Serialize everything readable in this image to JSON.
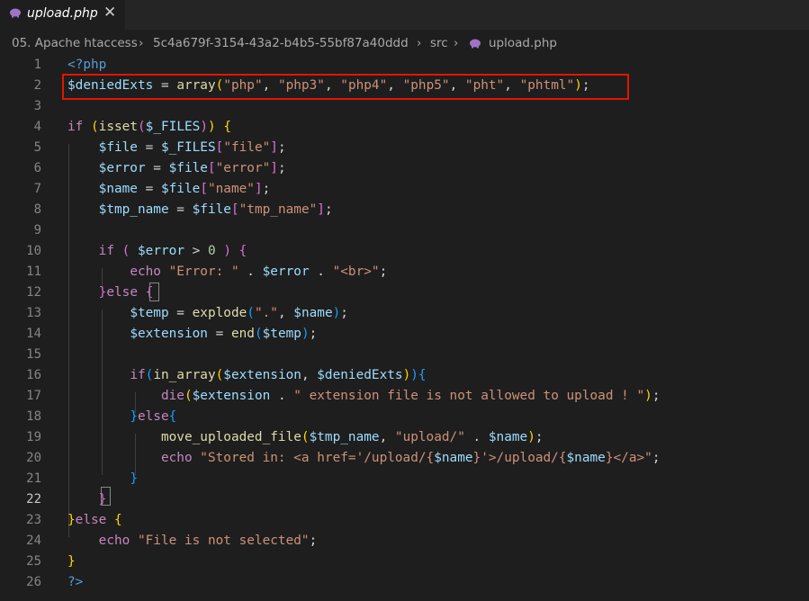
{
  "tab": {
    "label": "upload.php",
    "close": "✕",
    "icon": "php-elephant-icon"
  },
  "breadcrumb": {
    "items": [
      "05. Apache htaccess",
      "5c4a679f-3154-43a2-b4b5-55bf87a40ddd",
      "src",
      "upload.php"
    ],
    "separator": "›"
  },
  "editor": {
    "active_line": 22,
    "highlighted_line": 2,
    "highlight_color": "#e51400",
    "lines": [
      {
        "n": "1",
        "t": [
          [
            "<?php",
            "k"
          ]
        ]
      },
      {
        "n": "2",
        "t": [
          [
            "$deniedExts",
            "v"
          ],
          [
            " = ",
            ""
          ],
          [
            "array",
            "f"
          ],
          [
            "(",
            "p"
          ],
          [
            "\"php\"",
            "s"
          ],
          [
            ", ",
            ""
          ],
          [
            "\"php3\"",
            "s"
          ],
          [
            ", ",
            ""
          ],
          [
            "\"php4\"",
            "s"
          ],
          [
            ", ",
            ""
          ],
          [
            "\"php5\"",
            "s"
          ],
          [
            ", ",
            ""
          ],
          [
            "\"pht\"",
            "s"
          ],
          [
            ", ",
            ""
          ],
          [
            "\"phtml\"",
            "s"
          ],
          [
            ")",
            "p"
          ],
          [
            ";",
            ""
          ]
        ]
      },
      {
        "n": "3",
        "t": []
      },
      {
        "n": "4",
        "t": [
          [
            "if",
            "c"
          ],
          [
            " ",
            ""
          ],
          [
            "(",
            "p"
          ],
          [
            "isset",
            "f"
          ],
          [
            "(",
            "p2"
          ],
          [
            "$_FILES",
            "v"
          ],
          [
            ")",
            "p2"
          ],
          [
            ")",
            "p"
          ],
          [
            " ",
            ""
          ],
          [
            "{",
            "p"
          ]
        ]
      },
      {
        "n": "5",
        "t": [
          [
            "    ",
            ""
          ],
          [
            "$file",
            "v"
          ],
          [
            " = ",
            ""
          ],
          [
            "$_FILES",
            "v"
          ],
          [
            "[",
            "p2"
          ],
          [
            "\"file\"",
            "s"
          ],
          [
            "]",
            "p2"
          ],
          [
            ";",
            ""
          ]
        ]
      },
      {
        "n": "6",
        "t": [
          [
            "    ",
            ""
          ],
          [
            "$error",
            "v"
          ],
          [
            " = ",
            ""
          ],
          [
            "$file",
            "v"
          ],
          [
            "[",
            "p2"
          ],
          [
            "\"error\"",
            "s"
          ],
          [
            "]",
            "p2"
          ],
          [
            ";",
            ""
          ]
        ]
      },
      {
        "n": "7",
        "t": [
          [
            "    ",
            ""
          ],
          [
            "$name",
            "v"
          ],
          [
            " = ",
            ""
          ],
          [
            "$file",
            "v"
          ],
          [
            "[",
            "p2"
          ],
          [
            "\"name\"",
            "s"
          ],
          [
            "]",
            "p2"
          ],
          [
            ";",
            ""
          ]
        ]
      },
      {
        "n": "8",
        "t": [
          [
            "    ",
            ""
          ],
          [
            "$tmp_name",
            "v"
          ],
          [
            " = ",
            ""
          ],
          [
            "$file",
            "v"
          ],
          [
            "[",
            "p2"
          ],
          [
            "\"tmp_name\"",
            "s"
          ],
          [
            "]",
            "p2"
          ],
          [
            ";",
            ""
          ]
        ]
      },
      {
        "n": "9",
        "t": []
      },
      {
        "n": "10",
        "t": [
          [
            "    ",
            ""
          ],
          [
            "if",
            "c"
          ],
          [
            " ",
            ""
          ],
          [
            "(",
            "p2"
          ],
          [
            " ",
            ""
          ],
          [
            "$error",
            "v"
          ],
          [
            " > ",
            ""
          ],
          [
            "0",
            "n"
          ],
          [
            " ",
            ""
          ],
          [
            ")",
            "p2"
          ],
          [
            " ",
            ""
          ],
          [
            "{",
            "p2"
          ]
        ]
      },
      {
        "n": "11",
        "t": [
          [
            "        ",
            ""
          ],
          [
            "echo",
            "c"
          ],
          [
            " ",
            ""
          ],
          [
            "\"Error: \"",
            "s"
          ],
          [
            " . ",
            ""
          ],
          [
            "$error",
            "v"
          ],
          [
            " . ",
            ""
          ],
          [
            "\"<br>\"",
            "s"
          ],
          [
            ";",
            ""
          ]
        ]
      },
      {
        "n": "12",
        "t": [
          [
            "    ",
            ""
          ],
          [
            "}",
            "p2"
          ],
          [
            "else",
            "c"
          ],
          [
            " ",
            ""
          ],
          [
            "{",
            "p2"
          ]
        ]
      },
      {
        "n": "13",
        "t": [
          [
            "        ",
            ""
          ],
          [
            "$temp",
            "v"
          ],
          [
            " = ",
            ""
          ],
          [
            "explode",
            "f"
          ],
          [
            "(",
            "p3"
          ],
          [
            "\".\"",
            "s"
          ],
          [
            ", ",
            ""
          ],
          [
            "$name",
            "v"
          ],
          [
            ")",
            "p3"
          ],
          [
            ";",
            ""
          ]
        ]
      },
      {
        "n": "14",
        "t": [
          [
            "        ",
            ""
          ],
          [
            "$extension",
            "v"
          ],
          [
            " = ",
            ""
          ],
          [
            "end",
            "f"
          ],
          [
            "(",
            "p3"
          ],
          [
            "$temp",
            "v"
          ],
          [
            ")",
            "p3"
          ],
          [
            ";",
            ""
          ]
        ]
      },
      {
        "n": "15",
        "t": []
      },
      {
        "n": "16",
        "t": [
          [
            "        ",
            ""
          ],
          [
            "if",
            "c"
          ],
          [
            "(",
            "p3"
          ],
          [
            "in_array",
            "f"
          ],
          [
            "(",
            "p"
          ],
          [
            "$extension",
            "v"
          ],
          [
            ", ",
            ""
          ],
          [
            "$deniedExts",
            "v"
          ],
          [
            ")",
            "p"
          ],
          [
            ")",
            "p3"
          ],
          [
            "{",
            "p3"
          ]
        ]
      },
      {
        "n": "17",
        "t": [
          [
            "            ",
            ""
          ],
          [
            "die",
            "c"
          ],
          [
            "(",
            "p"
          ],
          [
            "$extension",
            "v"
          ],
          [
            " . ",
            ""
          ],
          [
            "\" extension file is not allowed to upload ! \"",
            "s"
          ],
          [
            ")",
            "p"
          ],
          [
            ";",
            ""
          ]
        ]
      },
      {
        "n": "18",
        "t": [
          [
            "        ",
            ""
          ],
          [
            "}",
            "p3"
          ],
          [
            "else",
            "c"
          ],
          [
            "{",
            "p3"
          ]
        ]
      },
      {
        "n": "19",
        "t": [
          [
            "            ",
            ""
          ],
          [
            "move_uploaded_file",
            "f"
          ],
          [
            "(",
            "p"
          ],
          [
            "$tmp_name",
            "v"
          ],
          [
            ", ",
            ""
          ],
          [
            "\"upload/\"",
            "s"
          ],
          [
            " . ",
            ""
          ],
          [
            "$name",
            "v"
          ],
          [
            ")",
            "p"
          ],
          [
            ";",
            ""
          ]
        ]
      },
      {
        "n": "20",
        "t": [
          [
            "            ",
            ""
          ],
          [
            "echo",
            "c"
          ],
          [
            " ",
            ""
          ],
          [
            "\"Stored in: <a href='/upload/{",
            "s"
          ],
          [
            "$name",
            "v"
          ],
          [
            "}'>/upload/{",
            "s"
          ],
          [
            "$name",
            "v"
          ],
          [
            "}</a>\"",
            "s"
          ],
          [
            ";",
            ""
          ]
        ]
      },
      {
        "n": "21",
        "t": [
          [
            "        ",
            ""
          ],
          [
            "}",
            "p3"
          ]
        ]
      },
      {
        "n": "22",
        "t": [
          [
            "    ",
            ""
          ],
          [
            "}",
            "p2"
          ]
        ]
      },
      {
        "n": "23",
        "t": [
          [
            "}",
            "p"
          ],
          [
            "else",
            "c"
          ],
          [
            " ",
            ""
          ],
          [
            "{",
            "p"
          ]
        ]
      },
      {
        "n": "24",
        "t": [
          [
            "    ",
            ""
          ],
          [
            "echo",
            "c"
          ],
          [
            " ",
            ""
          ],
          [
            "\"File is not selected\"",
            "s"
          ],
          [
            ";",
            ""
          ]
        ]
      },
      {
        "n": "25",
        "t": [
          [
            "}",
            "p"
          ]
        ]
      },
      {
        "n": "26",
        "t": [
          [
            "?>",
            "k"
          ]
        ]
      }
    ]
  }
}
